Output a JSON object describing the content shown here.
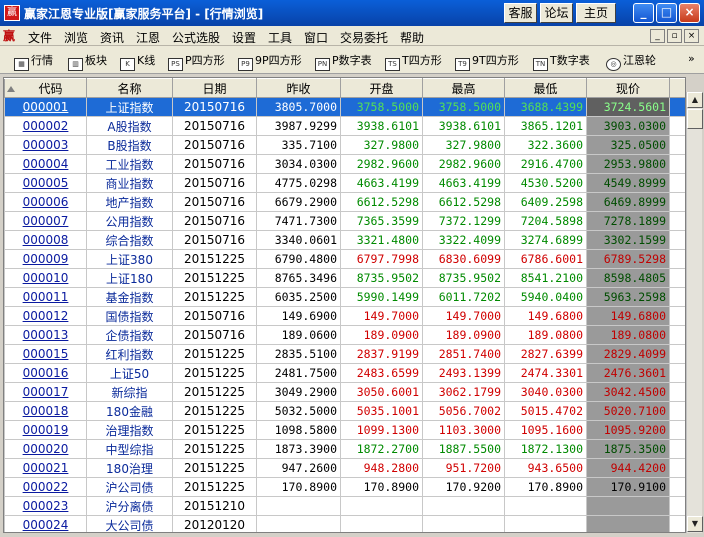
{
  "window": {
    "app_icon": "赢",
    "title": "赢家江恩专业版[赢家服务平台] - [行情浏览]",
    "top_buttons": [
      "客服",
      "论坛",
      "主页"
    ],
    "minimize": "_",
    "maximize": "□",
    "close": "×"
  },
  "menu": {
    "logo": "赢",
    "items": [
      "文件",
      "浏览",
      "资讯",
      "江恩",
      "公式选股",
      "设置",
      "工具",
      "窗口",
      "交易委托",
      "帮助"
    ],
    "mdi_min": "_",
    "mdi_restore": "▫",
    "mdi_close": "×"
  },
  "toolbar": {
    "items": [
      {
        "icon": "▦",
        "label": "行情"
      },
      {
        "icon": "▥",
        "label": "板块"
      },
      {
        "icon": "K",
        "label": "K线"
      },
      {
        "icon": "PS",
        "label": "P四方形"
      },
      {
        "icon": "P9",
        "label": "9P四方形"
      },
      {
        "icon": "PN",
        "label": "P数字表"
      },
      {
        "icon": "TS",
        "label": "T四方形"
      },
      {
        "icon": "T9",
        "label": "9T四方形"
      },
      {
        "icon": "TN",
        "label": "T数字表"
      },
      {
        "icon": "◎",
        "label": "江恩轮"
      }
    ],
    "more": "»"
  },
  "table": {
    "columns": [
      "代码",
      "名称",
      "日期",
      "昨收",
      "开盘",
      "最高",
      "最低",
      "现价"
    ],
    "rows": [
      {
        "code": "000001",
        "name": "上证指数",
        "date": "20150716",
        "prev": "3805.7000",
        "open": "3758.5000",
        "high": "3758.5000",
        "low": "3688.4399",
        "now": "3724.5601",
        "dir": "up",
        "selected": true
      },
      {
        "code": "000002",
        "name": "A股指数",
        "date": "20150716",
        "prev": "3987.9299",
        "open": "3938.6101",
        "high": "3938.6101",
        "low": "3865.1201",
        "now": "3903.0300",
        "dir": "up"
      },
      {
        "code": "000003",
        "name": "B股指数",
        "date": "20150716",
        "prev": "335.7100",
        "open": "327.9800",
        "high": "327.9800",
        "low": "322.3600",
        "now": "325.0500",
        "dir": "up"
      },
      {
        "code": "000004",
        "name": "工业指数",
        "date": "20150716",
        "prev": "3034.0300",
        "open": "2982.9600",
        "high": "2982.9600",
        "low": "2916.4700",
        "now": "2953.9800",
        "dir": "up"
      },
      {
        "code": "000005",
        "name": "商业指数",
        "date": "20150716",
        "prev": "4775.0298",
        "open": "4663.4199",
        "high": "4663.4199",
        "low": "4530.5200",
        "now": "4549.8999",
        "dir": "up"
      },
      {
        "code": "000006",
        "name": "地产指数",
        "date": "20150716",
        "prev": "6679.2900",
        "open": "6612.5298",
        "high": "6612.5298",
        "low": "6409.2598",
        "now": "6469.8999",
        "dir": "up"
      },
      {
        "code": "000007",
        "name": "公用指数",
        "date": "20150716",
        "prev": "7471.7300",
        "open": "7365.3599",
        "high": "7372.1299",
        "low": "7204.5898",
        "now": "7278.1899",
        "dir": "up"
      },
      {
        "code": "000008",
        "name": "综合指数",
        "date": "20150716",
        "prev": "3340.0601",
        "open": "3321.4800",
        "high": "3322.4099",
        "low": "3274.6899",
        "now": "3302.1599",
        "dir": "up"
      },
      {
        "code": "000009",
        "name": "上证380",
        "date": "20151225",
        "prev": "6790.4800",
        "open": "6797.7998",
        "high": "6830.6099",
        "low": "6786.6001",
        "now": "6789.5298",
        "dir": "down"
      },
      {
        "code": "000010",
        "name": "上证180",
        "date": "20151225",
        "prev": "8765.3496",
        "open": "8735.9502",
        "high": "8735.9502",
        "low": "8541.2100",
        "now": "8598.4805",
        "dir": "up"
      },
      {
        "code": "000011",
        "name": "基金指数",
        "date": "20151225",
        "prev": "6035.2500",
        "open": "5990.1499",
        "high": "6011.7202",
        "low": "5940.0400",
        "now": "5963.2598",
        "dir": "up"
      },
      {
        "code": "000012",
        "name": "国债指数",
        "date": "20150716",
        "prev": "149.6900",
        "open": "149.7000",
        "high": "149.7000",
        "low": "149.6800",
        "now": "149.6800",
        "dir": "down"
      },
      {
        "code": "000013",
        "name": "企债指数",
        "date": "20150716",
        "prev": "189.0600",
        "open": "189.0900",
        "high": "189.0900",
        "low": "189.0800",
        "now": "189.0800",
        "dir": "down"
      },
      {
        "code": "000015",
        "name": "红利指数",
        "date": "20151225",
        "prev": "2835.5100",
        "open": "2837.9199",
        "high": "2851.7400",
        "low": "2827.6399",
        "now": "2829.4099",
        "dir": "down"
      },
      {
        "code": "000016",
        "name": "上证50",
        "date": "20151225",
        "prev": "2481.7500",
        "open": "2483.6599",
        "high": "2493.1399",
        "low": "2474.3301",
        "now": "2476.3601",
        "dir": "down"
      },
      {
        "code": "000017",
        "name": "新综指",
        "date": "20151225",
        "prev": "3049.2900",
        "open": "3050.6001",
        "high": "3062.1799",
        "low": "3040.0300",
        "now": "3042.4500",
        "dir": "down"
      },
      {
        "code": "000018",
        "name": "180金融",
        "date": "20151225",
        "prev": "5032.5000",
        "open": "5035.1001",
        "high": "5056.7002",
        "low": "5015.4702",
        "now": "5020.7100",
        "dir": "down"
      },
      {
        "code": "000019",
        "name": "治理指数",
        "date": "20151225",
        "prev": "1098.5800",
        "open": "1099.1300",
        "high": "1103.3000",
        "low": "1095.1600",
        "now": "1095.9200",
        "dir": "down"
      },
      {
        "code": "000020",
        "name": "中型综指",
        "date": "20151225",
        "prev": "1873.3900",
        "open": "1872.2700",
        "high": "1887.5500",
        "low": "1872.1300",
        "now": "1875.3500",
        "dir": "up"
      },
      {
        "code": "000021",
        "name": "180治理",
        "date": "20151225",
        "prev": "947.2600",
        "open": "948.2800",
        "high": "951.7200",
        "low": "943.6500",
        "now": "944.4200",
        "dir": "down"
      },
      {
        "code": "000022",
        "name": "沪公司债",
        "date": "20151225",
        "prev": "170.8900",
        "open": "170.8900",
        "high": "170.9200",
        "low": "170.8900",
        "now": "170.9100",
        "dir": "flat"
      },
      {
        "code": "000023",
        "name": "沪分离债",
        "date": "20151210",
        "prev": "",
        "open": "",
        "high": "",
        "low": "",
        "now": "",
        "dir": "flat"
      },
      {
        "code": "000024",
        "name": "大公司债",
        "date": "20120120",
        "prev": "",
        "open": "",
        "high": "",
        "low": "",
        "now": "",
        "dir": "flat"
      }
    ]
  },
  "colors": {
    "up": "#008a00",
    "down": "#d00000",
    "selection": "#1e6bd6"
  }
}
